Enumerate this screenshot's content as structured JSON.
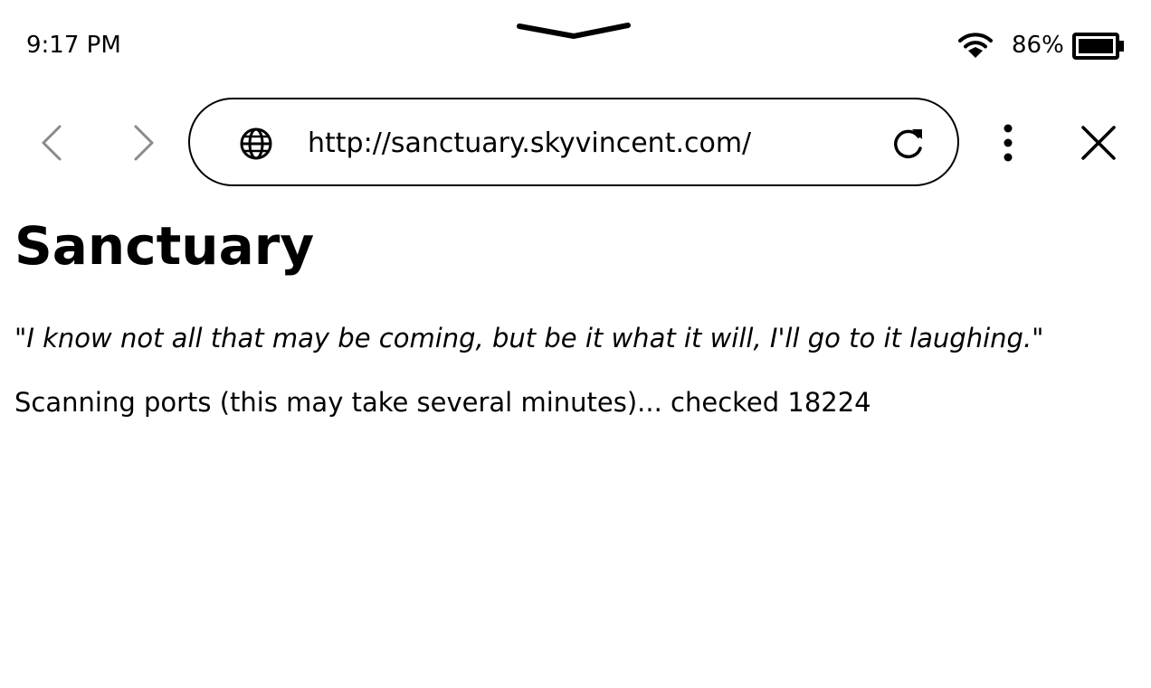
{
  "status_bar": {
    "time": "9:17 PM",
    "battery_percent": "86%",
    "battery_level": 0.86,
    "icons": [
      "pull-handle-icon",
      "wifi-icon",
      "battery-icon"
    ]
  },
  "toolbar": {
    "url": "http://sanctuary.skyvincent.com/",
    "icons": [
      "chevron-left-icon",
      "chevron-right-icon",
      "globe-icon",
      "reload-icon",
      "more-vertical-icon",
      "close-icon"
    ]
  },
  "page": {
    "heading": "Sanctuary",
    "quote": "\"I know not all that may be coming, but be it what it will, I'll go to it laughing.\"",
    "status_text": "Scanning ports (this may take several minutes)... checked 18224"
  },
  "colors": {
    "text": "#000000",
    "background": "#ffffff",
    "disabled_nav": "#8a8a8a"
  }
}
